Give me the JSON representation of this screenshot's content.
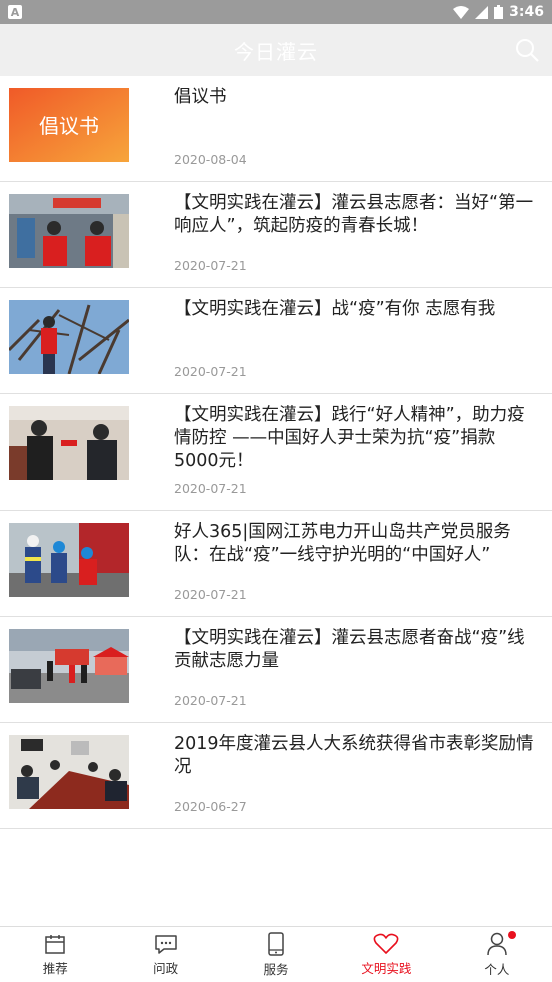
{
  "status_bar": {
    "time": "3:46",
    "notification_icon": "A"
  },
  "header": {
    "title": "今日灌云"
  },
  "articles": [
    {
      "title": "倡议书",
      "date": "2020-08-04",
      "thumb_text": "倡议书"
    },
    {
      "title": "【文明实践在灌云】灌云县志愿者：当好“第一响应人”，筑起防疫的青春长城！",
      "date": "2020-07-21"
    },
    {
      "title": "【文明实践在灌云】战“疫”有你 志愿有我",
      "date": "2020-07-21"
    },
    {
      "title": "【文明实践在灌云】践行“好人精神”，助力疫情防控 ——中国好人尹士荣为抗“疫”捐款5000元！",
      "date": "2020-07-21"
    },
    {
      "title": "好人365|国网江苏电力开山岛共产党员服务队：在战“疫”一线守护光明的“中国好人”",
      "date": "2020-07-21"
    },
    {
      "title": "【文明实践在灌云】灌云县志愿者奋战“疫”线贡献志愿力量",
      "date": "2020-07-21"
    },
    {
      "title": "2019年度灌云县人大系统获得省市表彰奖励情况",
      "date": "2020-06-27"
    }
  ],
  "bottom_nav": [
    {
      "label": "推荐",
      "icon": "calendar-icon"
    },
    {
      "label": "问政",
      "icon": "chat-icon"
    },
    {
      "label": "服务",
      "icon": "phone-icon"
    },
    {
      "label": "文明实践",
      "icon": "heart-icon",
      "active": true
    },
    {
      "label": "个人",
      "icon": "person-icon",
      "badge": true
    }
  ],
  "colors": {
    "accent": "#e8101e",
    "header_bg": "#efefef",
    "status_bg": "#9b9b9b"
  }
}
